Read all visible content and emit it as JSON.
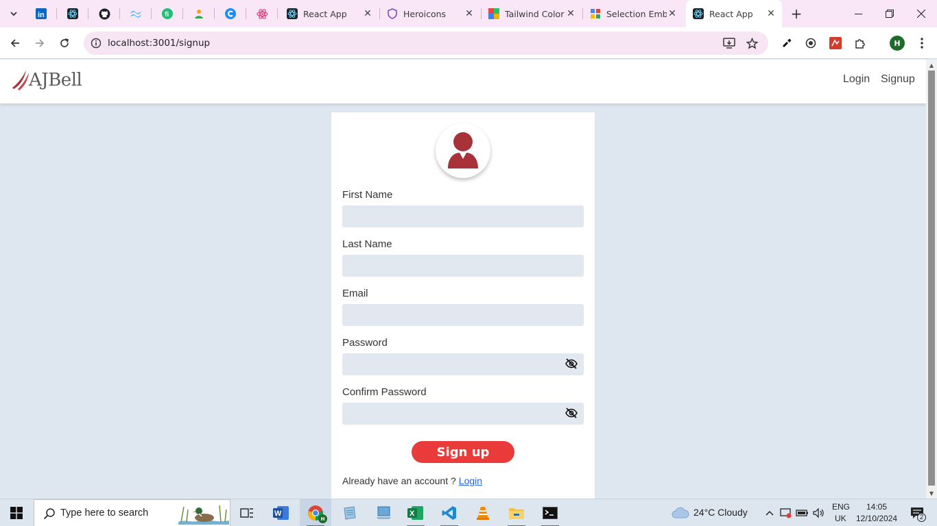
{
  "browser": {
    "tabs": [
      {
        "title": "React App",
        "icon": "react-icon"
      },
      {
        "title": "Heroicons",
        "icon": "heroicons-shield-icon"
      },
      {
        "title": "Tailwind Color",
        "icon": "tailwind-color-icon"
      },
      {
        "title": "Selection Emb",
        "icon": "selection-icon"
      },
      {
        "title": "React App",
        "icon": "react-icon"
      }
    ],
    "pinned_tabs": [
      "linkedin-icon",
      "react-dark-icon",
      "github-icon",
      "tailwind-icon",
      "fiverr-icon",
      "person-icon",
      "copilot-icon",
      "react-pink-icon"
    ],
    "url": "localhost:3001/signup",
    "profile_initial": "H"
  },
  "navbar": {
    "logo_text": "AJBell",
    "links": [
      "Login",
      "Signup"
    ]
  },
  "form": {
    "fields": [
      {
        "label": "First Name",
        "value": ""
      },
      {
        "label": "Last Name",
        "value": ""
      },
      {
        "label": "Email",
        "value": ""
      },
      {
        "label": "Password",
        "value": ""
      },
      {
        "label": "Confirm Password",
        "value": ""
      }
    ],
    "submit_label": "Sign up",
    "already_text": "Already have an account ?",
    "login_link": "Login"
  },
  "taskbar": {
    "search_placeholder": "Type here to search",
    "weather": "24°C  Cloudy",
    "lang_line1": "ENG",
    "lang_line2": "UK",
    "time": "14:05",
    "date": "12/10/2024",
    "notification_count": "2"
  },
  "colors": {
    "brand_red": "#a8323a",
    "button_red": "#ea3b3b",
    "link_blue": "#2563eb",
    "page_bg": "#dee6ef",
    "input_bg": "#e2e8f0",
    "tab_strip": "#f9e6f6"
  }
}
